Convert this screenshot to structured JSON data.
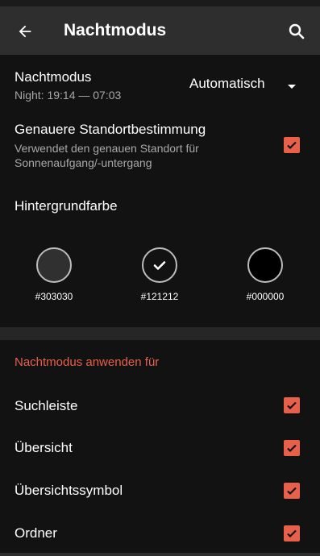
{
  "appbar": {
    "title": "Nachtmodus"
  },
  "night_mode": {
    "label": "Nachtmodus",
    "schedule": "Night: 19:14 — 07:03",
    "selected_option": "Automatisch"
  },
  "precise_location": {
    "label": "Genauere Standortbestimmung",
    "description": "Verwendet den genauen Standort für Sonnenaufgang/-untergang",
    "checked": true
  },
  "background_color": {
    "label": "Hintergrundfarbe",
    "swatches": [
      {
        "hex": "#303030",
        "selected": false
      },
      {
        "hex": "#121212",
        "selected": true
      },
      {
        "hex": "#000000",
        "selected": false
      }
    ]
  },
  "apply_section": {
    "header": "Nachtmodus anwenden für",
    "items": [
      {
        "label": "Suchleiste",
        "checked": true
      },
      {
        "label": "Übersicht",
        "checked": true
      },
      {
        "label": "Übersichtssymbol",
        "checked": true
      },
      {
        "label": "Ordner",
        "checked": true
      }
    ]
  },
  "colors": {
    "accent": "#e8604a",
    "background": "#121212",
    "appbar": "#2e2e2e"
  },
  "icons": {
    "back": "arrow-left-icon",
    "search": "search-icon",
    "dropdown": "caret-down-icon",
    "check": "check-icon"
  }
}
